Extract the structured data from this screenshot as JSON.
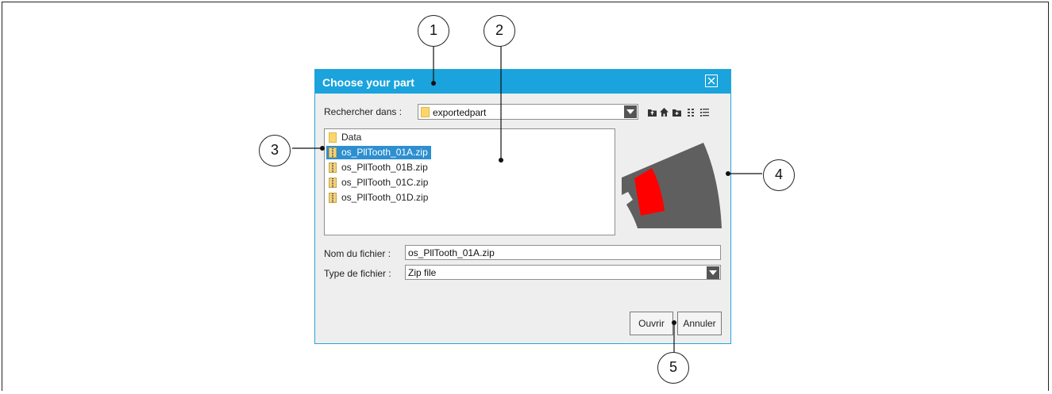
{
  "dialog": {
    "title": "Choose your part",
    "look_in_label": "Rechercher dans :",
    "look_in_value": "exportedpart",
    "files": [
      {
        "name": "Data",
        "type": "folder",
        "selected": false
      },
      {
        "name": "os_PllTooth_01A.zip",
        "type": "zip",
        "selected": true
      },
      {
        "name": "os_PllTooth_01B.zip",
        "type": "zip",
        "selected": false
      },
      {
        "name": "os_PllTooth_01C.zip",
        "type": "zip",
        "selected": false
      },
      {
        "name": "os_PllTooth_01D.zip",
        "type": "zip",
        "selected": false
      }
    ],
    "filename_label": "Nom du fichier :",
    "filename_value": "os_PllTooth_01A.zip",
    "filetype_label": "Type de fichier :",
    "filetype_value": "Zip file",
    "open_label": "Ouvrir",
    "cancel_label": "Annuler",
    "preview_colors": {
      "sector": "#5f5f5f",
      "highlight": "#ff0000"
    }
  },
  "callouts": [
    "1",
    "2",
    "3",
    "4",
    "5"
  ],
  "toolbar_icons": [
    "up-folder-icon",
    "home-icon",
    "new-folder-icon",
    "list-view-icon",
    "details-view-icon"
  ]
}
